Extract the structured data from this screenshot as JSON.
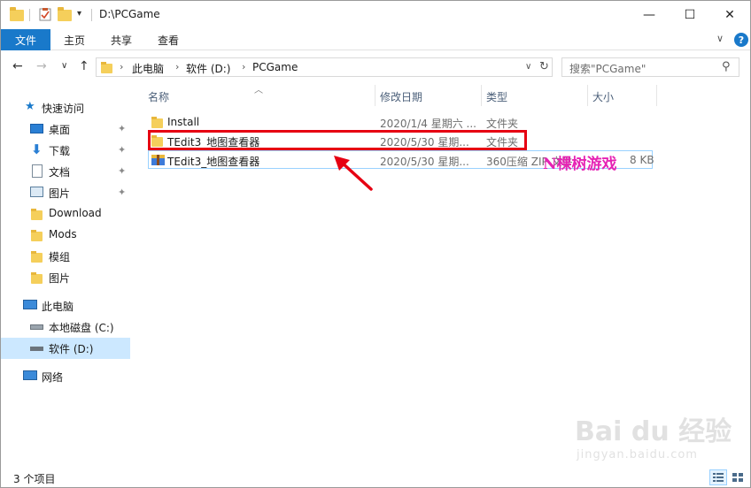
{
  "window": {
    "title": "D:\\PCGame",
    "minimize": "—",
    "maximize": "☐",
    "close": "✕"
  },
  "ribbon": {
    "tabs": [
      "文件",
      "主页",
      "共享",
      "查看"
    ],
    "collapse_glyph": "∨",
    "help_glyph": "?"
  },
  "nav": {
    "back": "←",
    "forward": "→",
    "recent": "∨",
    "up": "↑",
    "breadcrumb": [
      "此电脑",
      "软件 (D:)",
      "PCGame"
    ],
    "refresh": "↻",
    "search_placeholder": "搜索\"PCGame\"",
    "search_glyph": "⚲"
  },
  "sidebar": {
    "quick_access": "快速访问",
    "items": [
      {
        "label": "桌面",
        "icon": "desktop-icon",
        "pinned": true
      },
      {
        "label": "下载",
        "icon": "download-icon",
        "pinned": true
      },
      {
        "label": "文档",
        "icon": "document-icon",
        "pinned": true
      },
      {
        "label": "图片",
        "icon": "pictures-icon",
        "pinned": true
      },
      {
        "label": "Download",
        "icon": "folder-icon",
        "pinned": false
      },
      {
        "label": "Mods",
        "icon": "folder-icon",
        "pinned": false
      },
      {
        "label": "模组",
        "icon": "folder-icon",
        "pinned": false
      },
      {
        "label": "图片",
        "icon": "folder-icon",
        "pinned": false
      }
    ],
    "this_pc": "此电脑",
    "drives": [
      {
        "label": "本地磁盘 (C:)",
        "icon": "drive-c-icon"
      },
      {
        "label": "软件 (D:)",
        "icon": "drive-d-icon"
      }
    ],
    "network": "网络",
    "pin_glyph": "📌"
  },
  "columns": {
    "name": "名称",
    "date": "修改日期",
    "type": "类型",
    "size": "大小",
    "sort_glyph": "︿"
  },
  "files": [
    {
      "name": "Install",
      "date": "2020/1/4 星期六 ...",
      "type": "文件夹",
      "size": "",
      "icon": "folder-icon"
    },
    {
      "name": "TEdit3_地图查看器",
      "date": "2020/5/30 星期...",
      "type": "文件夹",
      "size": "",
      "icon": "folder-icon"
    },
    {
      "name": "TEdit3_地图查看器",
      "date": "2020/5/30 星期...",
      "type": "360压缩 ZIP 文件",
      "size": "8 KB",
      "icon": "zip-archive-icon"
    }
  ],
  "annotation": {
    "text": "N棵树游戏"
  },
  "status": {
    "count": "3 个项目"
  },
  "watermark": {
    "main": "Bai du 经验",
    "sub": "jingyan.baidu.com"
  },
  "colors": {
    "accent": "#1979ca",
    "selection": "#cce8ff",
    "highlight_box": "#e60012",
    "annotation": "#e623b4",
    "folder": "#f5cf5b"
  }
}
